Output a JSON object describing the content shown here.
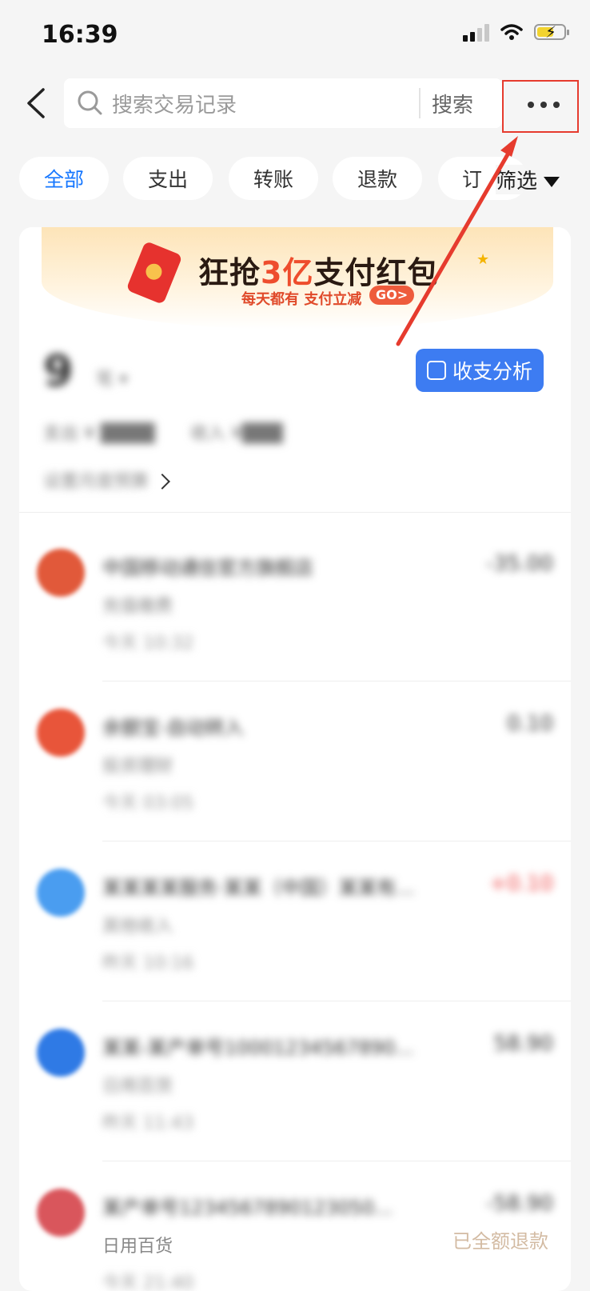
{
  "status_bar": {
    "time": "16:39"
  },
  "header": {
    "search_placeholder": "搜索交易记录",
    "search_button": "搜索"
  },
  "filters": {
    "chips": [
      {
        "label": "全部",
        "active": true
      },
      {
        "label": "支出",
        "active": false
      },
      {
        "label": "转账",
        "active": false
      },
      {
        "label": "退款",
        "active": false
      },
      {
        "label": "订",
        "active": false
      }
    ],
    "filter_button": "筛选"
  },
  "banner": {
    "title_pre": "狂抢",
    "title_highlight": "3亿",
    "title_post": "支付红包",
    "subtitle": "每天都有 支付立减",
    "go": "GO>"
  },
  "summary": {
    "count": "9",
    "unit": "笔 ▾",
    "out_text": "支出 ¥ ████",
    "in_text": "收入 ¥███",
    "budget_text": "设置月度预算",
    "analysis_button": "收支分析"
  },
  "transactions": [
    {
      "name": "中国移动通信官方旗舰店",
      "amount": "-35.00",
      "category": "充值缴费",
      "time": "今天 10:32",
      "amount_color": "#333333",
      "icon_color": "#e1593a"
    },
    {
      "name": "余额宝-自动转入",
      "amount": "0.10",
      "category": "投资理财",
      "time": "今天 03:05",
      "amount_color": "#333333",
      "icon_color": "#e8553a"
    },
    {
      "name": "某某某某服务·某某（中国）某某有...",
      "amount": "+0.10",
      "category": "其他收入",
      "time": "昨天 10:16",
      "amount_color": "#ee4444",
      "icon_color": "#4a9df0"
    },
    {
      "name": "某某-某产单号10001234567890...",
      "amount": "58.90",
      "category": "日用百货",
      "time": "昨天 11:43",
      "amount_color": "#333333",
      "icon_color": "#2f7ae5"
    },
    {
      "name": "某产单号1234567890123050...",
      "amount": "-58.90",
      "category": "日用百货",
      "time": "今天 21:40",
      "amount_color": "#333333",
      "icon_color": "#d9565c"
    }
  ],
  "watermark": "已全额退款"
}
